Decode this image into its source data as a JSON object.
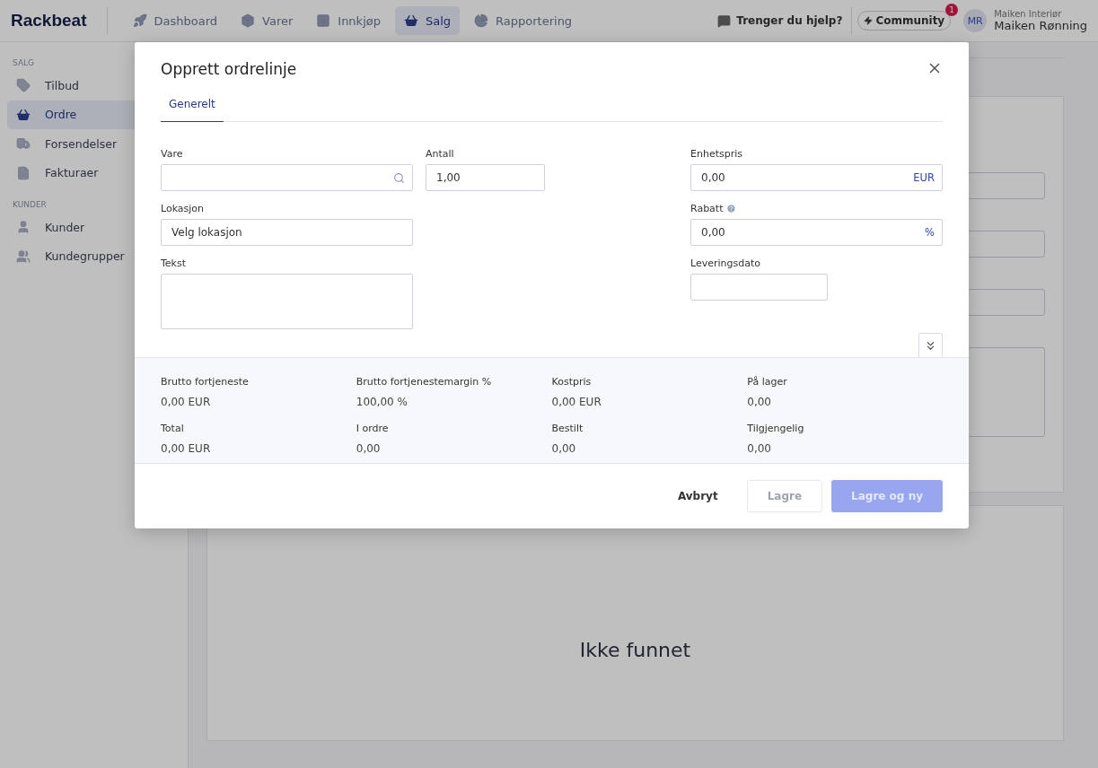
{
  "header": {
    "logo": "Rackbeat",
    "nav": [
      {
        "label": "Dashboard",
        "selected": false
      },
      {
        "label": "Varer",
        "selected": false
      },
      {
        "label": "Innkjøp",
        "selected": false
      },
      {
        "label": "Salg",
        "selected": true
      },
      {
        "label": "Rapportering",
        "selected": false
      }
    ],
    "help": "Trenger du hjelp?",
    "community": {
      "label": "Community",
      "badge": "1"
    },
    "user": {
      "initials": "MR",
      "company": "Maiken Interiør",
      "name": "Maiken Rønning"
    }
  },
  "sidebar": [
    {
      "heading": "SALG",
      "items": [
        {
          "label": "Tilbud",
          "selected": false
        },
        {
          "label": "Ordre",
          "selected": true
        },
        {
          "label": "Forsendelser",
          "selected": false
        },
        {
          "label": "Fakturaer",
          "selected": false
        }
      ]
    },
    {
      "heading": "KUNDER",
      "items": [
        {
          "label": "Kunder",
          "selected": false
        },
        {
          "label": "Kundegrupper",
          "selected": false
        }
      ]
    }
  ],
  "background": {
    "empty_text": "Ikke funnet"
  },
  "modal": {
    "title": "Opprett ordrelinje",
    "tabs": [
      {
        "label": "Generelt",
        "selected": true
      }
    ],
    "fields": [
      {
        "label": "Vare",
        "kind": "search"
      },
      {
        "label": "Antall",
        "kind": "text",
        "value": "1,00"
      },
      {
        "label": "Enhetspris",
        "kind": "text",
        "value": "0,00",
        "suffix": "EUR"
      },
      {
        "label": "Lokasjon",
        "kind": "select",
        "value": "Velg lokasjon"
      },
      {
        "label": "Rabatt",
        "kind": "text",
        "value": "0,00",
        "suffix": "%",
        "help": true
      },
      {
        "label": "Tekst",
        "kind": "textarea"
      },
      {
        "label": "Leveringsdato",
        "kind": "date"
      }
    ],
    "stats": [
      {
        "label": "Brutto fortjeneste",
        "value": "0,00 EUR"
      },
      {
        "label": "Brutto fortjenestemargin %",
        "value": "100,00 %"
      },
      {
        "label": "Kostpris",
        "value": "0,00 EUR"
      },
      {
        "label": "På lager",
        "value": "0,00"
      },
      {
        "label": "Total",
        "value": "0,00 EUR"
      },
      {
        "label": "I ordre",
        "value": "0,00"
      },
      {
        "label": "Bestilt",
        "value": "0,00"
      },
      {
        "label": "Tilgjengelig",
        "value": "0,00"
      }
    ],
    "buttons": [
      {
        "label": "Avbryt",
        "kind": "link",
        "disabled": false
      },
      {
        "label": "Lagre",
        "kind": "secondary",
        "disabled": true
      },
      {
        "label": "Lagre og ny",
        "kind": "primary",
        "disabled": true
      }
    ]
  }
}
